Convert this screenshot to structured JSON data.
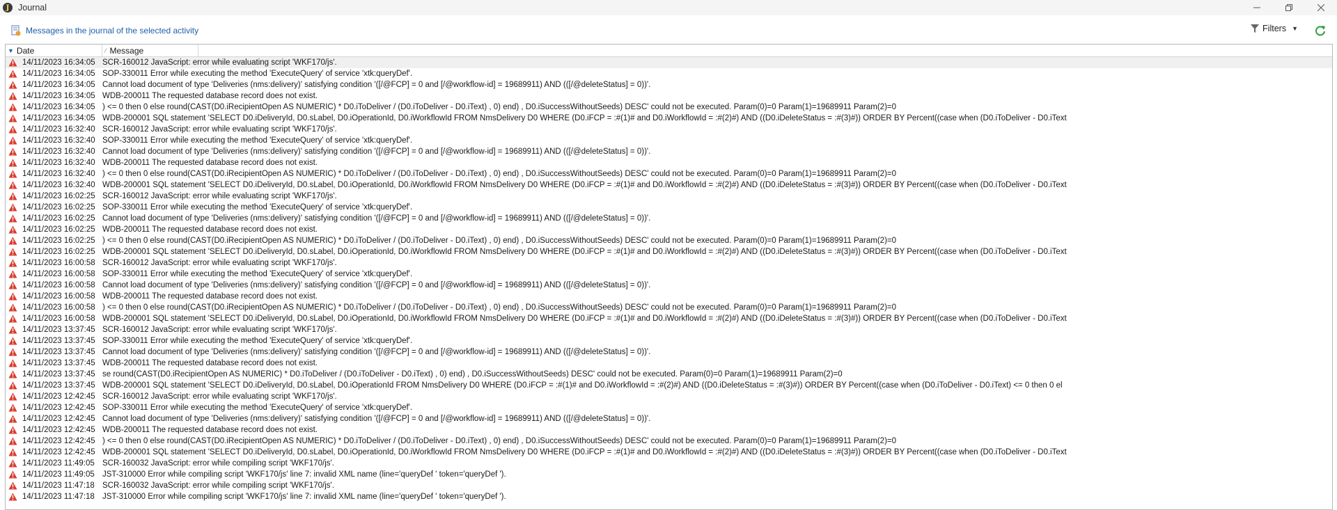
{
  "window": {
    "title": "Journal",
    "icon": "journal-app-icon"
  },
  "toolbar": {
    "journal_link": "Messages in the journal of the selected activity",
    "filters_label": "Filters"
  },
  "grid": {
    "columns": {
      "date": "Date",
      "message": "Message"
    },
    "rows": [
      {
        "date": "14/11/2023 16:34:05",
        "message": "SCR-160012 JavaScript: error while evaluating script 'WKF170/js'."
      },
      {
        "date": "14/11/2023 16:34:05",
        "message": "SOP-330011 Error while executing the method 'ExecuteQuery' of service 'xtk:queryDef'."
      },
      {
        "date": "14/11/2023 16:34:05",
        "message": "Cannot load document of type 'Deliveries (nms:delivery)' satisfying condition '([/@FCP] = 0 and [/@workflow-id] = 19689911) AND (([/@deleteStatus] = 0))'."
      },
      {
        "date": "14/11/2023 16:34:05",
        "message": "WDB-200011 The requested database record does not exist."
      },
      {
        "date": "14/11/2023 16:34:05",
        "message": ") <= 0 then 0 else round(CAST(D0.iRecipientOpen AS NUMERIC) * D0.iToDeliver / (D0.iToDeliver - D0.iText) , 0) end) , D0.iSuccessWithoutSeeds) DESC' could not be executed.   Param(0)=0   Param(1)=19689911   Param(2)=0"
      },
      {
        "date": "14/11/2023 16:34:05",
        "message": "WDB-200001 SQL statement 'SELECT   D0.iDeliveryId, D0.sLabel, D0.iOperationId, D0.iWorkflowId FROM NmsDelivery D0 WHERE (D0.iFCP = :#(1)# and D0.iWorkflowId = :#(2)#) AND ((D0.iDeleteStatus = :#(3)#)) ORDER BY Percent((case when (D0.iToDeliver - D0.iText"
      },
      {
        "date": "14/11/2023 16:32:40",
        "message": "SCR-160012 JavaScript: error while evaluating script 'WKF170/js'."
      },
      {
        "date": "14/11/2023 16:32:40",
        "message": "SOP-330011 Error while executing the method 'ExecuteQuery' of service 'xtk:queryDef'."
      },
      {
        "date": "14/11/2023 16:32:40",
        "message": "Cannot load document of type 'Deliveries (nms:delivery)' satisfying condition '([/@FCP] = 0 and [/@workflow-id] = 19689911) AND (([/@deleteStatus] = 0))'."
      },
      {
        "date": "14/11/2023 16:32:40",
        "message": "WDB-200011 The requested database record does not exist."
      },
      {
        "date": "14/11/2023 16:32:40",
        "message": ") <= 0 then 0 else round(CAST(D0.iRecipientOpen AS NUMERIC) * D0.iToDeliver / (D0.iToDeliver - D0.iText) , 0) end) , D0.iSuccessWithoutSeeds) DESC' could not be executed.   Param(0)=0   Param(1)=19689911   Param(2)=0"
      },
      {
        "date": "14/11/2023 16:32:40",
        "message": "WDB-200001 SQL statement 'SELECT   D0.iDeliveryId, D0.sLabel, D0.iOperationId, D0.iWorkflowId FROM NmsDelivery D0 WHERE (D0.iFCP = :#(1)# and D0.iWorkflowId = :#(2)#) AND ((D0.iDeleteStatus = :#(3)#)) ORDER BY Percent((case when (D0.iToDeliver - D0.iText"
      },
      {
        "date": "14/11/2023 16:02:25",
        "message": "SCR-160012 JavaScript: error while evaluating script 'WKF170/js'."
      },
      {
        "date": "14/11/2023 16:02:25",
        "message": "SOP-330011 Error while executing the method 'ExecuteQuery' of service 'xtk:queryDef'."
      },
      {
        "date": "14/11/2023 16:02:25",
        "message": "Cannot load document of type 'Deliveries (nms:delivery)' satisfying condition '([/@FCP] = 0 and [/@workflow-id] = 19689911) AND (([/@deleteStatus] = 0))'."
      },
      {
        "date": "14/11/2023 16:02:25",
        "message": "WDB-200011 The requested database record does not exist."
      },
      {
        "date": "14/11/2023 16:02:25",
        "message": ") <= 0 then 0 else round(CAST(D0.iRecipientOpen AS NUMERIC) * D0.iToDeliver / (D0.iToDeliver - D0.iText) , 0) end) , D0.iSuccessWithoutSeeds) DESC' could not be executed.   Param(0)=0   Param(1)=19689911   Param(2)=0"
      },
      {
        "date": "14/11/2023 16:02:25",
        "message": "WDB-200001 SQL statement 'SELECT   D0.iDeliveryId, D0.sLabel, D0.iOperationId, D0.iWorkflowId FROM NmsDelivery D0 WHERE (D0.iFCP = :#(1)# and D0.iWorkflowId = :#(2)#) AND ((D0.iDeleteStatus = :#(3)#)) ORDER BY Percent((case when (D0.iToDeliver - D0.iText"
      },
      {
        "date": "14/11/2023 16:00:58",
        "message": "SCR-160012 JavaScript: error while evaluating script 'WKF170/js'."
      },
      {
        "date": "14/11/2023 16:00:58",
        "message": "SOP-330011 Error while executing the method 'ExecuteQuery' of service 'xtk:queryDef'."
      },
      {
        "date": "14/11/2023 16:00:58",
        "message": "Cannot load document of type 'Deliveries (nms:delivery)' satisfying condition '([/@FCP] = 0 and [/@workflow-id] = 19689911) AND (([/@deleteStatus] = 0))'."
      },
      {
        "date": "14/11/2023 16:00:58",
        "message": "WDB-200011 The requested database record does not exist."
      },
      {
        "date": "14/11/2023 16:00:58",
        "message": ") <= 0 then 0 else round(CAST(D0.iRecipientOpen AS NUMERIC) * D0.iToDeliver / (D0.iToDeliver - D0.iText) , 0) end) , D0.iSuccessWithoutSeeds) DESC' could not be executed.   Param(0)=0   Param(1)=19689911   Param(2)=0"
      },
      {
        "date": "14/11/2023 16:00:58",
        "message": "WDB-200001 SQL statement 'SELECT   D0.iDeliveryId, D0.sLabel, D0.iOperationId, D0.iWorkflowId FROM NmsDelivery D0 WHERE (D0.iFCP = :#(1)# and D0.iWorkflowId = :#(2)#) AND ((D0.iDeleteStatus = :#(3)#)) ORDER BY Percent((case when (D0.iToDeliver - D0.iText"
      },
      {
        "date": "14/11/2023 13:37:45",
        "message": "SCR-160012 JavaScript: error while evaluating script 'WKF170/js'."
      },
      {
        "date": "14/11/2023 13:37:45",
        "message": "SOP-330011 Error while executing the method 'ExecuteQuery' of service 'xtk:queryDef'."
      },
      {
        "date": "14/11/2023 13:37:45",
        "message": "Cannot load document of type 'Deliveries (nms:delivery)' satisfying condition '([/@FCP] = 0 and [/@workflow-id] = 19689911) AND (([/@deleteStatus] = 0))'."
      },
      {
        "date": "14/11/2023 13:37:45",
        "message": "WDB-200011 The requested database record does not exist."
      },
      {
        "date": "14/11/2023 13:37:45",
        "message": "se round(CAST(D0.iRecipientOpen AS NUMERIC) * D0.iToDeliver / (D0.iToDeliver - D0.iText) , 0) end) , D0.iSuccessWithoutSeeds) DESC' could not be executed.   Param(0)=0   Param(1)=19689911   Param(2)=0"
      },
      {
        "date": "14/11/2023 13:37:45",
        "message": "WDB-200001 SQL statement 'SELECT   D0.iDeliveryId, D0.sLabel, D0.iOperationId FROM NmsDelivery D0 WHERE (D0.iFCP = :#(1)# and D0.iWorkflowId = :#(2)#) AND ((D0.iDeleteStatus = :#(3)#)) ORDER BY Percent((case when (D0.iToDeliver - D0.iText) <= 0 then 0 el"
      },
      {
        "date": "14/11/2023 12:42:45",
        "message": "SCR-160012 JavaScript: error while evaluating script 'WKF170/js'."
      },
      {
        "date": "14/11/2023 12:42:45",
        "message": "SOP-330011 Error while executing the method 'ExecuteQuery' of service 'xtk:queryDef'."
      },
      {
        "date": "14/11/2023 12:42:45",
        "message": "Cannot load document of type 'Deliveries (nms:delivery)' satisfying condition '([/@FCP] = 0 and [/@workflow-id] = 19689911) AND (([/@deleteStatus] = 0))'."
      },
      {
        "date": "14/11/2023 12:42:45",
        "message": "WDB-200011 The requested database record does not exist."
      },
      {
        "date": "14/11/2023 12:42:45",
        "message": ") <= 0 then 0 else round(CAST(D0.iRecipientOpen AS NUMERIC) * D0.iToDeliver / (D0.iToDeliver - D0.iText) , 0) end) , D0.iSuccessWithoutSeeds) DESC' could not be executed.   Param(0)=0   Param(1)=19689911   Param(2)=0"
      },
      {
        "date": "14/11/2023 12:42:45",
        "message": "WDB-200001 SQL statement 'SELECT   D0.iDeliveryId, D0.sLabel, D0.iOperationId, D0.iWorkflowId FROM NmsDelivery D0 WHERE (D0.iFCP = :#(1)# and D0.iWorkflowId = :#(2)#) AND ((D0.iDeleteStatus = :#(3)#)) ORDER BY Percent((case when (D0.iToDeliver - D0.iText"
      },
      {
        "date": "14/11/2023 11:49:05",
        "message": "SCR-160032 JavaScript: error while compiling script 'WKF170/js'."
      },
      {
        "date": "14/11/2023 11:49:05",
        "message": "JST-310000 Error while compiling script 'WKF170/js' line 7: invalid XML name (line='queryDef ' token='queryDef ')."
      },
      {
        "date": "14/11/2023 11:47:18",
        "message": "SCR-160032 JavaScript: error while compiling script 'WKF170/js'."
      },
      {
        "date": "14/11/2023 11:47:18",
        "message": "JST-310000 Error while compiling script 'WKF170/js' line 7: invalid XML name (line='queryDef ' token='queryDef ')."
      }
    ]
  },
  "colors": {
    "link": "#1f5fa8",
    "error_icon": "#d93b2b",
    "refresh": "#2e9e3a"
  }
}
